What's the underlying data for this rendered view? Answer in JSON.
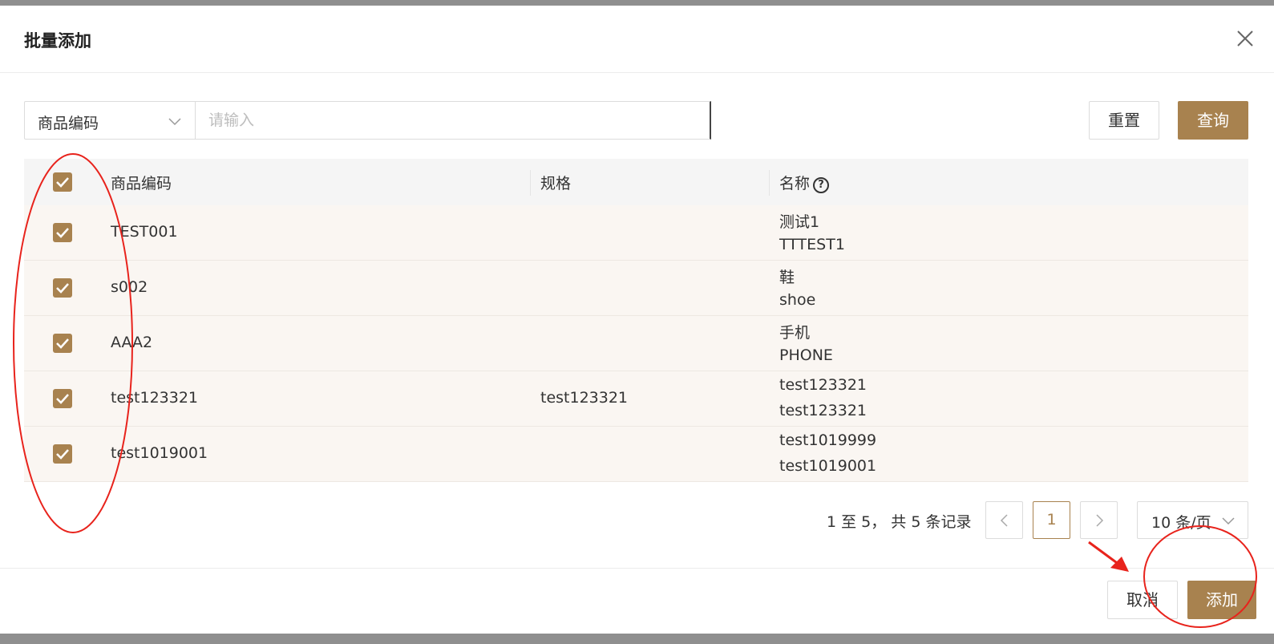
{
  "modal": {
    "title": "批量添加"
  },
  "filter": {
    "field_label": "商品编码",
    "placeholder": "请输入",
    "reset_label": "重置",
    "query_label": "查询"
  },
  "table": {
    "columns": [
      "商品编码",
      "规格",
      "名称"
    ],
    "rows": [
      {
        "code": "TEST001",
        "spec": "",
        "name": "测试1",
        "name_en": "TTTEST1",
        "checked": true
      },
      {
        "code": "s002",
        "spec": "",
        "name": "鞋",
        "name_en": "shoe",
        "checked": true
      },
      {
        "code": "AAA2",
        "spec": "",
        "name": "手机",
        "name_en": "PHONE",
        "checked": true
      },
      {
        "code": "test123321",
        "spec": "test123321",
        "name": "test123321",
        "name_en": "test123321",
        "checked": true
      },
      {
        "code": "test1019001",
        "spec": "",
        "name": "test1019999",
        "name_en": "test1019001",
        "checked": true
      }
    ]
  },
  "pagination": {
    "info": "1 至 5， 共 5 条记录",
    "current_page": "1",
    "page_size": "10 条/页"
  },
  "footer": {
    "cancel_label": "取消",
    "add_label": "添加"
  },
  "colors": {
    "accent": "#a8824f",
    "annotation": "#e8231c"
  }
}
